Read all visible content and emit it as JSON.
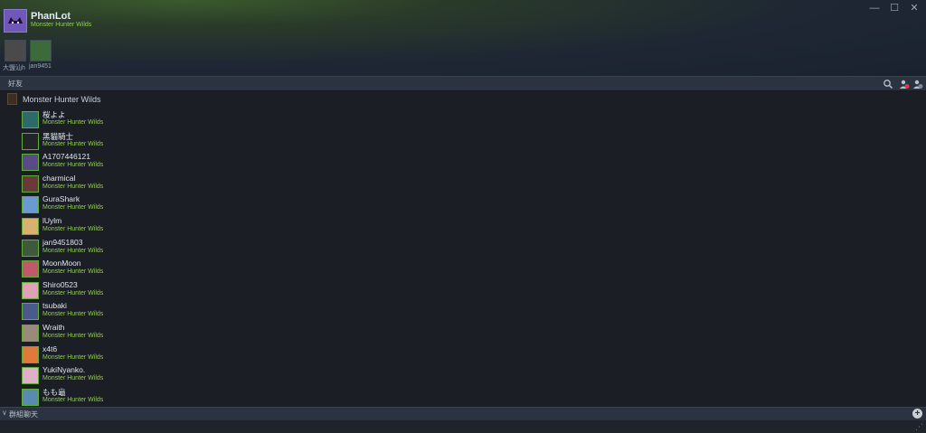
{
  "window": {
    "min_glyph": "—",
    "max_glyph": "☐",
    "close_glyph": "✕"
  },
  "self": {
    "name": "PhanLot",
    "game": "Monster Hunter Wilds",
    "avatar_color": "#6f58b8"
  },
  "recent_chats": [
    {
      "label": "大鹽汕h",
      "color": "#4a4a4a"
    },
    {
      "label": "jan9451",
      "color": "#3d6a3a"
    }
  ],
  "friends_bar": {
    "title": "好友"
  },
  "group": {
    "name": "Monster Hunter Wilds"
  },
  "friends": [
    {
      "name": "桜よよ",
      "game": "Monster Hunter Wilds",
      "color": "#2e6a6a"
    },
    {
      "name": "黑貓騎士",
      "game": "Monster Hunter Wilds",
      "color": "#222428"
    },
    {
      "name": "A1707446121",
      "game": "Monster Hunter Wilds",
      "color": "#5a4a8a"
    },
    {
      "name": "charmical",
      "game": "Monster Hunter Wilds",
      "color": "#6a3a3a"
    },
    {
      "name": "GuraShark",
      "game": "Monster Hunter Wilds",
      "color": "#6a9ad0"
    },
    {
      "name": "lUylm",
      "game": "Monster Hunter Wilds",
      "color": "#d8b070"
    },
    {
      "name": "jan9451803",
      "game": "Monster Hunter Wilds",
      "color": "#3d5a3a"
    },
    {
      "name": "MoonMoon",
      "game": "Monster Hunter Wilds",
      "color": "#c05a6a"
    },
    {
      "name": "Shiro0523",
      "game": "Monster Hunter Wilds",
      "color": "#e0a0b8"
    },
    {
      "name": "tsubaki",
      "game": "Monster Hunter Wilds",
      "color": "#4a5a8a"
    },
    {
      "name": "Wraith",
      "game": "Monster Hunter Wilds",
      "color": "#9a8a7a"
    },
    {
      "name": "x4t6",
      "game": "Monster Hunter Wilds",
      "color": "#e07a3a"
    },
    {
      "name": "YukiNyanko.",
      "game": "Monster Hunter Wilds",
      "color": "#e0b0c8"
    },
    {
      "name": "もも龜",
      "game": "Monster Hunter Wilds",
      "color": "#5a8ab0"
    }
  ],
  "footer": {
    "label": "群組聊天",
    "add_glyph": "+"
  },
  "colors": {
    "accent_green": "#8fcf4a",
    "online_border": "#5fae38",
    "notif_red": "#d84040"
  }
}
